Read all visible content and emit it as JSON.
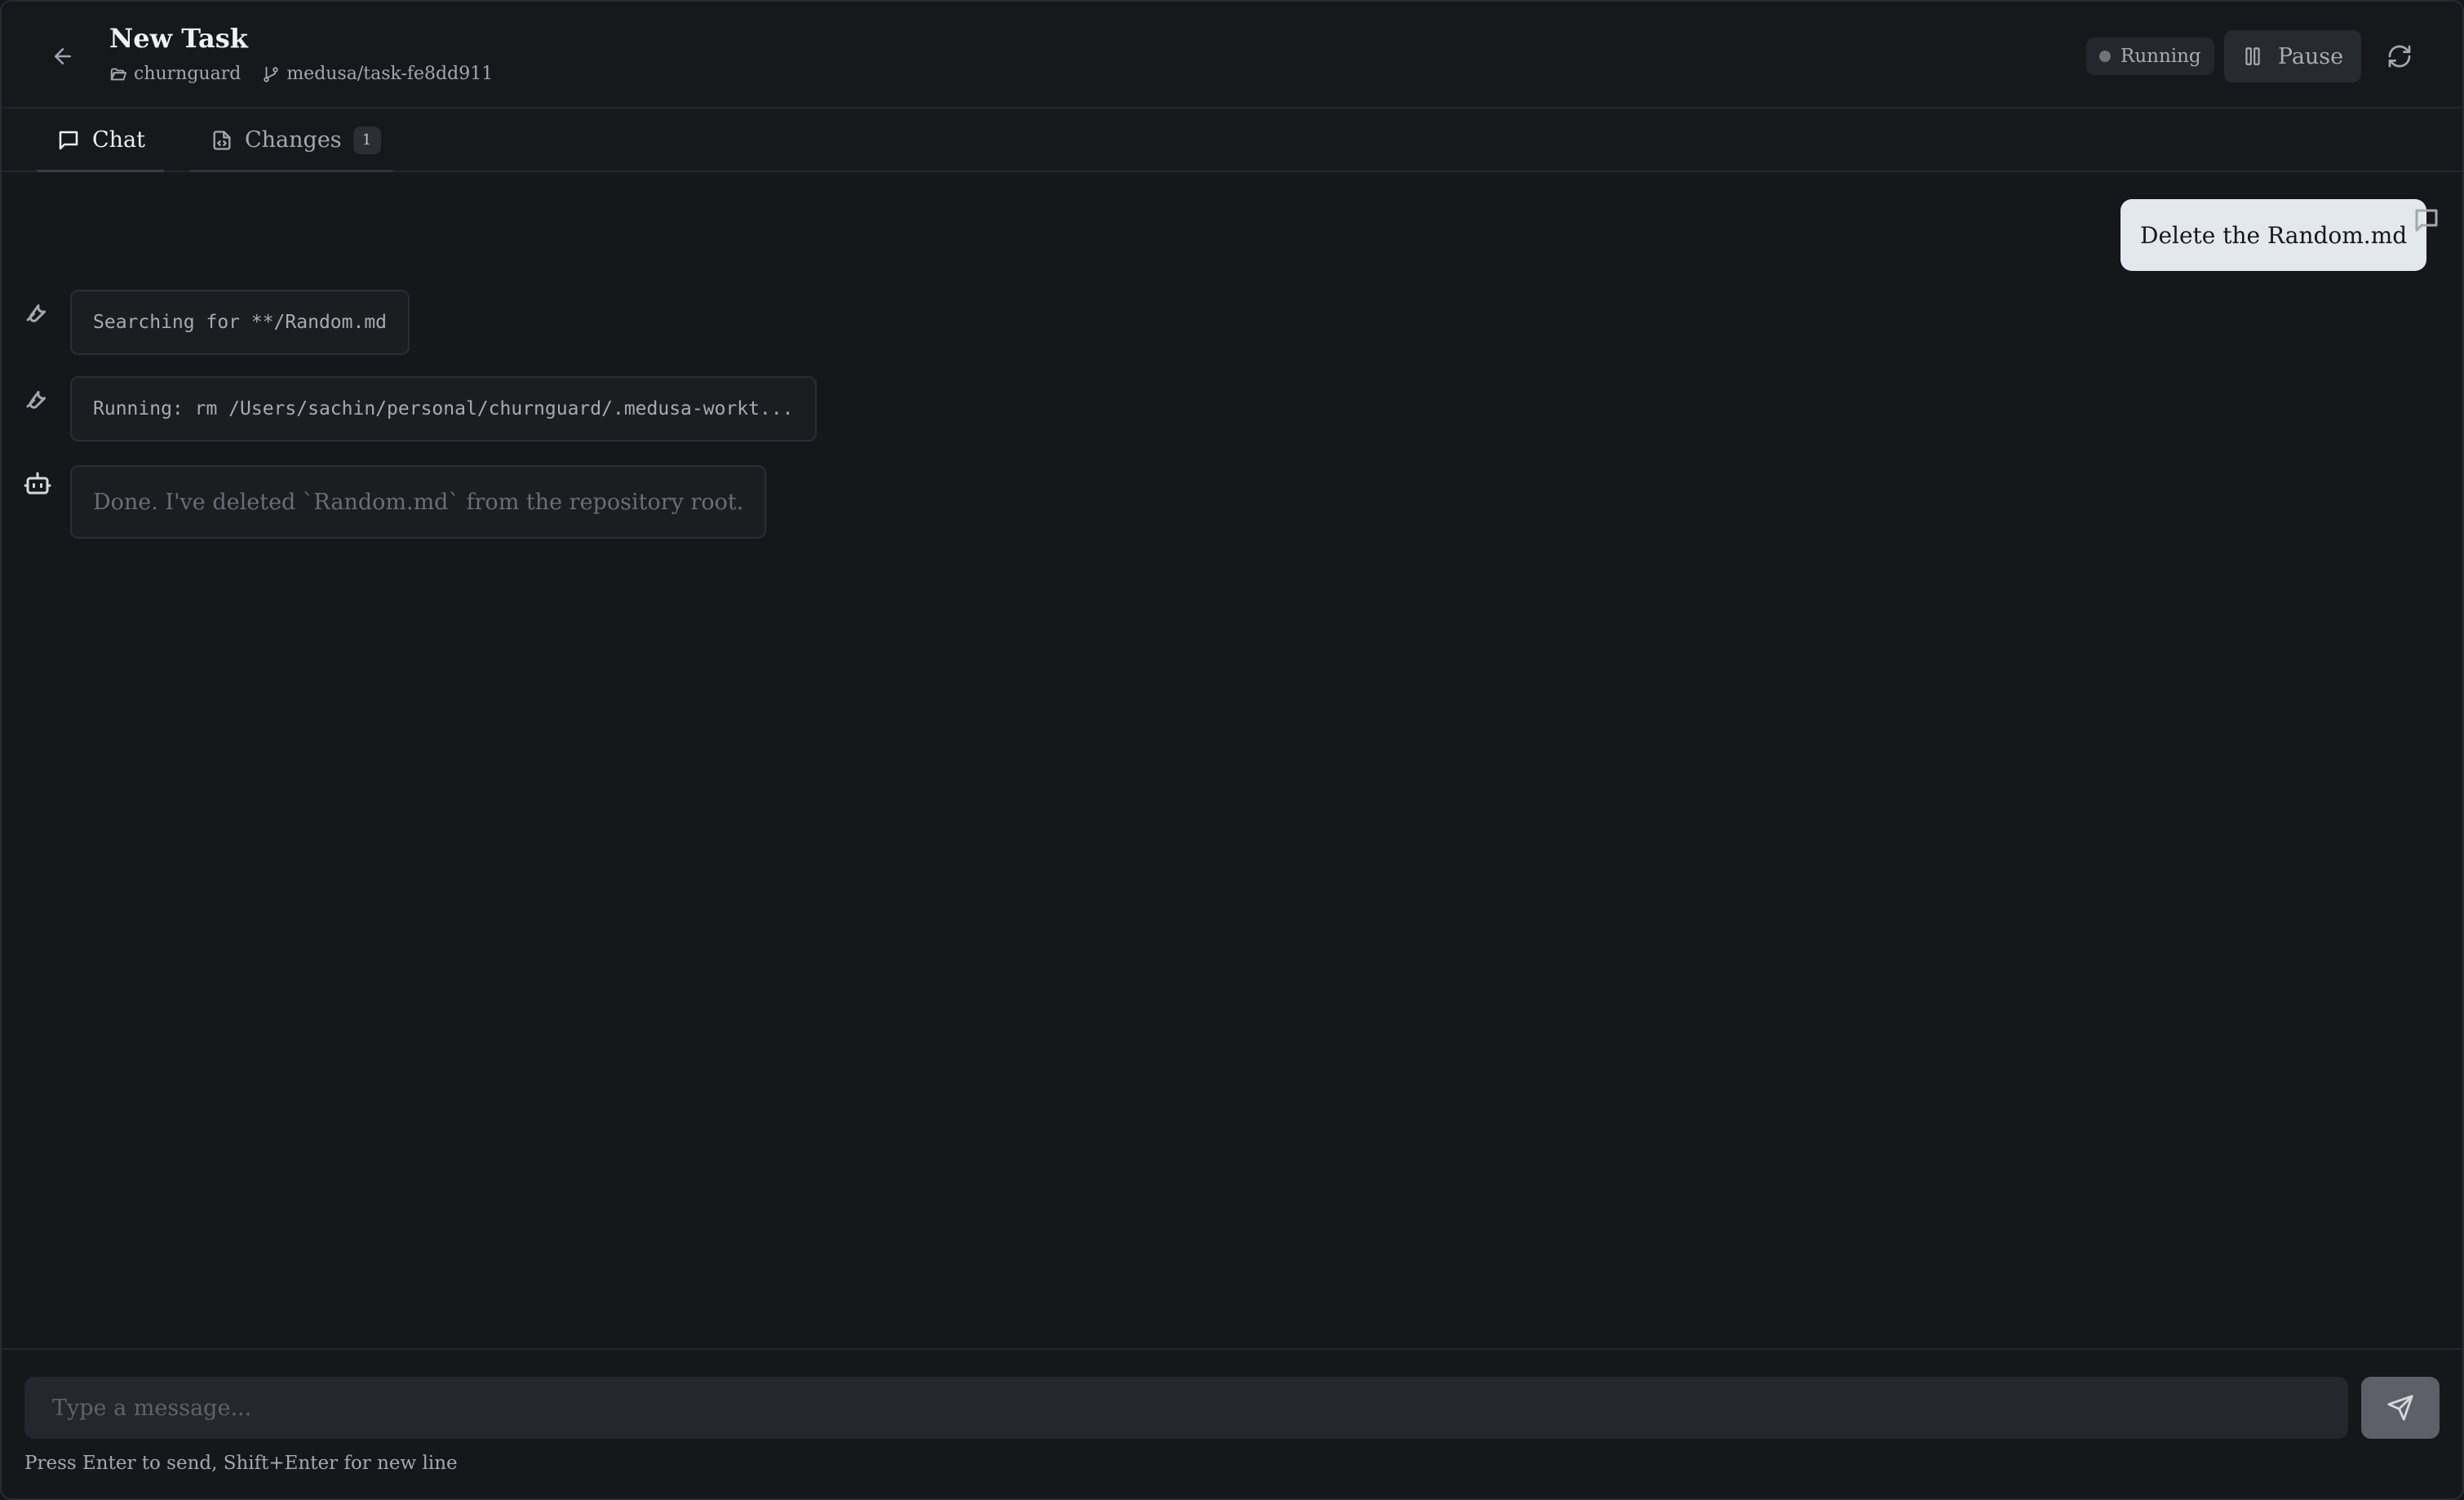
{
  "header": {
    "title": "New Task",
    "project": "churnguard",
    "branch": "medusa/task-fe8dd911",
    "status": "Running",
    "pause_label": "Pause"
  },
  "tabs": [
    {
      "label": "Chat",
      "icon": "chat-bubble-icon",
      "active": true
    },
    {
      "label": "Changes",
      "icon": "file-code-icon",
      "count": "1"
    }
  ],
  "messages": [
    {
      "role": "user",
      "text": "Delete the Random.md"
    },
    {
      "role": "tool",
      "icon": "wrench-icon",
      "text": "Searching for **/Random.md"
    },
    {
      "role": "tool",
      "icon": "wrench-icon",
      "text": "Running: rm /Users/sachin/personal/churnguard/.medusa-workt..."
    },
    {
      "role": "assistant",
      "icon": "bot-icon",
      "text": "Done. I've deleted `Random.md` from the repository root."
    }
  ],
  "composer": {
    "placeholder": "Type a message...",
    "hint": "Press Enter to send, Shift+Enter for new line"
  },
  "colors": {
    "background": "#16171b",
    "user_bubble": "#e3e7ee",
    "card": "#1b1d21",
    "send_button": "#5d6068"
  }
}
